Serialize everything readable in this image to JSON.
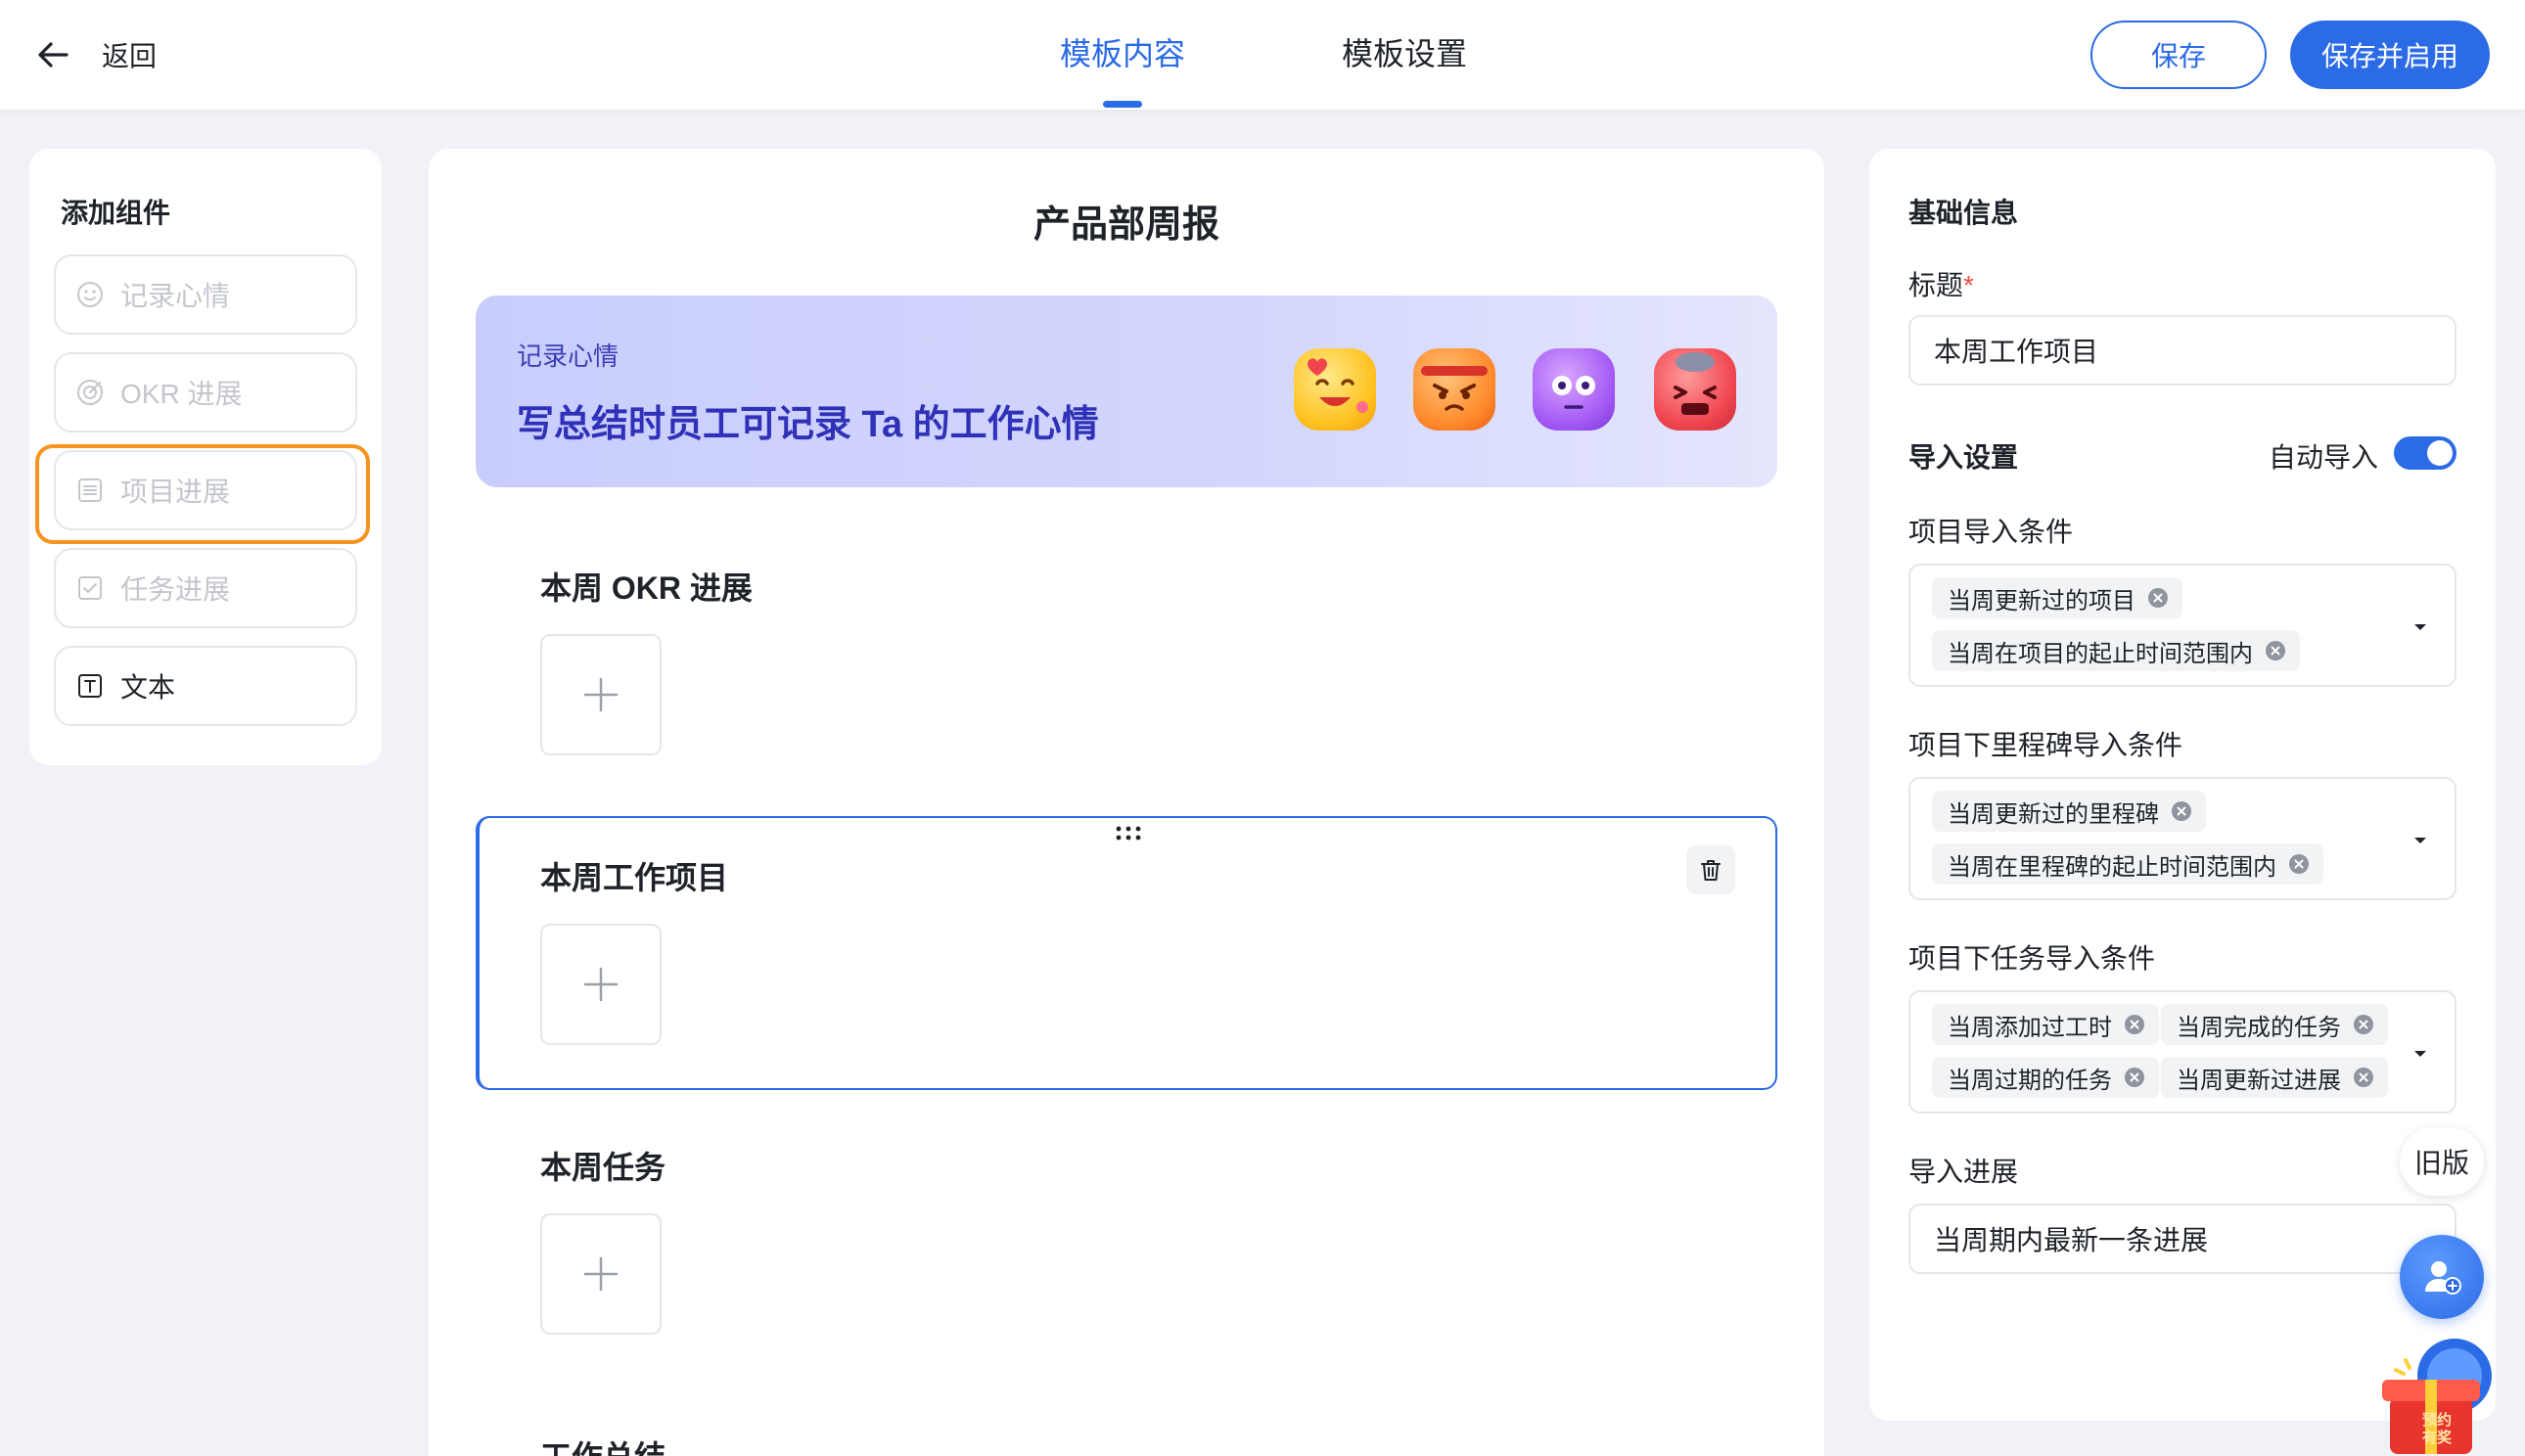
{
  "header": {
    "back_label": "返回",
    "tabs": [
      {
        "label": "模板内容",
        "active": true
      },
      {
        "label": "模板设置",
        "active": false
      }
    ],
    "save_label": "保存",
    "save_enable_label": "保存并启用"
  },
  "components_panel": {
    "title": "添加组件",
    "items": [
      {
        "label": "记录心情",
        "icon": "smile-icon",
        "enabled": false
      },
      {
        "label": "OKR 进展",
        "icon": "target-icon",
        "enabled": false
      },
      {
        "label": "项目进展",
        "icon": "list-icon",
        "enabled": false,
        "highlighted": true
      },
      {
        "label": "任务进展",
        "icon": "task-check-icon",
        "enabled": false
      },
      {
        "label": "文本",
        "icon": "text-t-icon",
        "enabled": true
      }
    ]
  },
  "template": {
    "title": "产品部周报",
    "mood_banner": {
      "label": "记录心情",
      "description": "写总结时员工可记录 Ta 的工作心情",
      "emojis": [
        "love-emoji",
        "angry-emoji",
        "dazed-emoji",
        "furious-emoji"
      ]
    },
    "sections": [
      {
        "title": "本周 OKR 进展",
        "selected": false
      },
      {
        "title": "本周工作项目",
        "selected": true
      },
      {
        "title": "本周任务",
        "selected": false
      },
      {
        "title": "工作总结",
        "selected": false
      }
    ]
  },
  "settings_panel": {
    "basic_info_title": "基础信息",
    "title_field_label": "标题",
    "required_mark": "*",
    "title_field_value": "本周工作项目",
    "import_settings_title": "导入设置",
    "auto_import_label": "自动导入",
    "auto_import_on": true,
    "project_conditions_label": "项目导入条件",
    "project_conditions": [
      "当周更新过的项目",
      "当周在项目的起止时间范围内"
    ],
    "milestone_conditions_label": "项目下里程碑导入条件",
    "milestone_conditions": [
      "当周更新过的里程碑",
      "当周在里程碑的起止时间范围内"
    ],
    "task_conditions_label": "项目下任务导入条件",
    "task_conditions": [
      "当周添加过工时",
      "当周完成的任务",
      "当周过期的任务",
      "当周更新过进展"
    ],
    "progress_label": "导入进展",
    "progress_value": "当周期内最新一条进展"
  },
  "floating": {
    "old_version_label": "旧版",
    "promo_text_line1": "预约",
    "promo_text_line2": "有奖"
  },
  "colors": {
    "accent": "#2b6be6",
    "highlight": "#f7931e",
    "banner_text": "#2f31b8"
  }
}
